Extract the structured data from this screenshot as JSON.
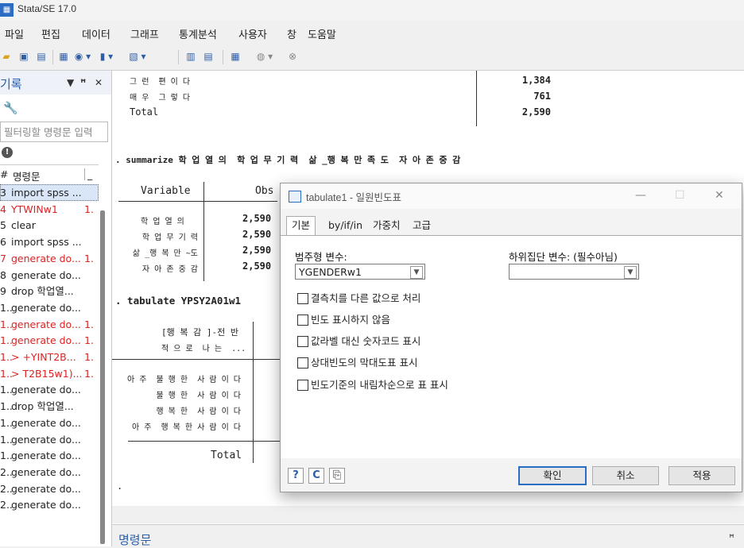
{
  "app": {
    "title": "Stata/SE 17.0",
    "icon_text": "▦"
  },
  "menu": [
    "파일",
    "편집",
    "데이터",
    "그래프",
    "통계분석",
    "사용자",
    "창",
    "도움말"
  ],
  "history": {
    "title": "기록",
    "controls": [
      "▼",
      "ꟸ",
      "✕"
    ],
    "filter_placeholder": "필터링할 명령문 입력",
    "col_num": "#",
    "col_cmd": "명령문",
    "col_rc": "_",
    "rows": [
      {
        "n": "3",
        "cmd": "import spss ...",
        "rc": "",
        "err": false,
        "sel": true
      },
      {
        "n": "4",
        "cmd": "YTWINw1",
        "rc": "1.",
        "err": true,
        "sel": false
      },
      {
        "n": "5",
        "cmd": "clear",
        "rc": "",
        "err": false,
        "sel": false
      },
      {
        "n": "6",
        "cmd": "import spss ...",
        "rc": "",
        "err": false,
        "sel": false
      },
      {
        "n": "7",
        "cmd": "generate do...",
        "rc": "1.",
        "err": true,
        "sel": false
      },
      {
        "n": "8",
        "cmd": "generate do...",
        "rc": "",
        "err": false,
        "sel": false
      },
      {
        "n": "9",
        "cmd": "drop 학업열...",
        "rc": "",
        "err": false,
        "sel": false
      },
      {
        "n": "1..",
        "cmd": "generate do...",
        "rc": "",
        "err": false,
        "sel": false
      },
      {
        "n": "1..",
        "cmd": "generate do...",
        "rc": "1.",
        "err": true,
        "sel": false
      },
      {
        "n": "1..",
        "cmd": "generate do...",
        "rc": "1.",
        "err": true,
        "sel": false
      },
      {
        "n": "1..",
        "cmd": "> +YINT2B...",
        "rc": "1.",
        "err": true,
        "sel": false
      },
      {
        "n": "1..",
        "cmd": "> T2B15w1)...",
        "rc": "1.",
        "err": true,
        "sel": false
      },
      {
        "n": "1..",
        "cmd": "generate do...",
        "rc": "",
        "err": false,
        "sel": false
      },
      {
        "n": "1..",
        "cmd": "drop 학업열...",
        "rc": "",
        "err": false,
        "sel": false
      },
      {
        "n": "1..",
        "cmd": "generate do...",
        "rc": "",
        "err": false,
        "sel": false
      },
      {
        "n": "1..",
        "cmd": "generate do...",
        "rc": "",
        "err": false,
        "sel": false
      },
      {
        "n": "1..",
        "cmd": "generate do...",
        "rc": "",
        "err": false,
        "sel": false
      },
      {
        "n": "2..",
        "cmd": "generate do...",
        "rc": "",
        "err": false,
        "sel": false
      },
      {
        "n": "2..",
        "cmd": "generate do...",
        "rc": "",
        "err": false,
        "sel": false
      },
      {
        "n": "2..",
        "cmd": "generate do...",
        "rc": "",
        "err": false,
        "sel": false
      }
    ]
  },
  "results": {
    "top_rows": [
      {
        "label": "그 런  편 이 다",
        "value": "1,384"
      },
      {
        "label": "매 우  그 렇 다",
        "value": "761"
      },
      {
        "label": "Total",
        "value": "2,590"
      }
    ],
    "summarize_cmd": ". summarize 학 업 열 의  학 업 무 기 력  삶 _행 복 만 족 도  자 아 존 중 감",
    "sum_header_var": "Variable",
    "sum_header_obs": "Obs",
    "sum_rows": [
      {
        "label": "학 업 열 의",
        "obs": "2,590"
      },
      {
        "label": "학 업 무 기 력",
        "obs": "2,590"
      },
      {
        "label": "삶 _행 복 만 ~도",
        "obs": "2,590"
      },
      {
        "label": "자 아 존 중 감",
        "obs": "2,590"
      }
    ],
    "tabulate_cmd": ". tabulate YPSY2A01w1",
    "tab_header1": "[행 복 감 ]-전 반",
    "tab_header2": "적 으 로  나 는  ...",
    "tab_rows": [
      "아 주  불 행 한  사 람 이 다",
      "불 행 한  사 람 이 다",
      "행 복 한  사 람 이 다",
      "아 주  행 복 한 사 람 이 다"
    ],
    "tab_total": "Total",
    "prompt": "."
  },
  "command_panel": {
    "title": "명령문",
    "pin": "ꟸ"
  },
  "dialog": {
    "title": "tabulate1 - 일원빈도표",
    "window_controls": [
      "—",
      "☐",
      "✕"
    ],
    "tabs": [
      "기본",
      "by/if/in",
      "가중치",
      "고급"
    ],
    "cat_var_label": "범주형 변수:",
    "cat_var_value": "YGENDERw1",
    "subpop_label": "하위집단 변수: (필수아님)",
    "subpop_value": "",
    "checkboxes": [
      "결측치를 다른 값으로 처리",
      "빈도 표시하지 않음",
      "값라벨 대신 숫자코드 표시",
      "상대빈도의 막대도표 표시",
      "빈도기준의 내림차순으로 표 표시"
    ],
    "icon_buttons": [
      "?",
      "C",
      "⎘"
    ],
    "ok_label": "확인",
    "cancel_label": "취소",
    "apply_label": "적용"
  }
}
